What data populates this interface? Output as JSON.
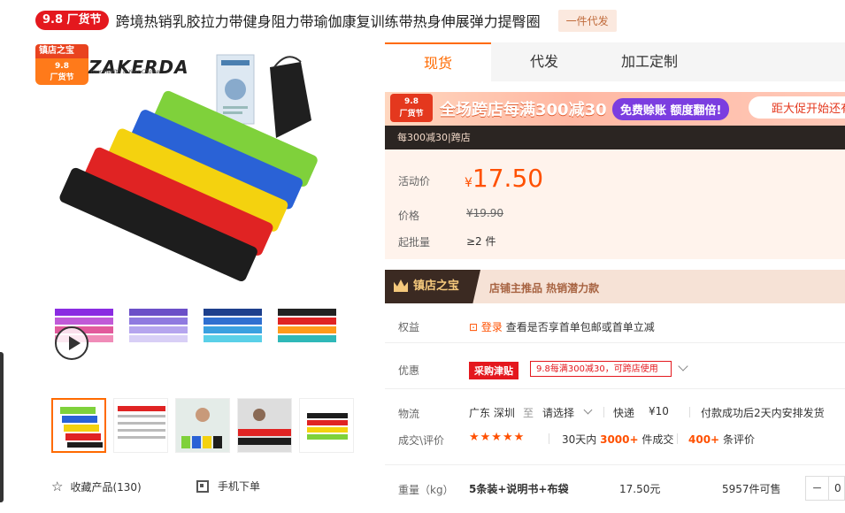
{
  "header": {
    "festival_badge": "9.8 厂货节",
    "title": "跨境热销乳胶拉力带健身阻力带瑜伽康复训练带热身伸展弹力提臀圈",
    "dropship_tag": "一件代发"
  },
  "gallery": {
    "shop_badge_top": "镇店之宝",
    "shop_badge_bottom": "9.8\n厂货节",
    "brand": "ZAKERDA",
    "brand_sub": "Your Health & Your Choice",
    "collect_label": "收藏产品(130)",
    "mobile_order_label": "手机下单"
  },
  "tabs": [
    {
      "label": "现货",
      "active": true
    },
    {
      "label": "代发",
      "active": false
    },
    {
      "label": "加工定制",
      "active": false
    }
  ],
  "promo": {
    "logo_text": "9.8\n厂货节",
    "main_text": "全场跨店每满300减30",
    "pill_text": "免费赊账 额度翻倍!",
    "right_text": "距大促开始还有",
    "sub_text": "每300减30|跨店"
  },
  "price": {
    "activity_label": "活动价",
    "currency": "¥",
    "activity_value": "17.50",
    "price_label": "价格",
    "original": "¥19.90",
    "moq_label": "起批量",
    "moq_value": "≥2 件"
  },
  "treasure": {
    "title": "镇店之宝",
    "text": "店铺主推品  热销潜力款"
  },
  "benefits": {
    "label": "权益",
    "login": "登录",
    "text": "查看是否享首单包邮或首单立减"
  },
  "coupon": {
    "label": "优惠",
    "tag": "采购津贴",
    "detail": "9.8每满300减30，可跨店使用"
  },
  "logistics": {
    "label": "物流",
    "origin": "广东 深圳",
    "to": "至",
    "select": "请选择",
    "express": "快递",
    "fee": "¥10",
    "ship_note": "付款成功后2天内安排发货"
  },
  "deals": {
    "label": "成交\\评价",
    "stars": "★★★★★",
    "days_prefix": "30天内",
    "count": "3000+",
    "count_suffix": "件成交",
    "reviews": "400+",
    "reviews_suffix": "条评价"
  },
  "spec": {
    "label": "重量（kg）",
    "name": "5条装+说明书+布袋",
    "price": "17.50元",
    "stock": "5957件可售",
    "minus": "−",
    "qty": "0"
  },
  "colors": {
    "accent": "#ff6a00",
    "price": "#ff5000",
    "red": "#e4181e"
  }
}
